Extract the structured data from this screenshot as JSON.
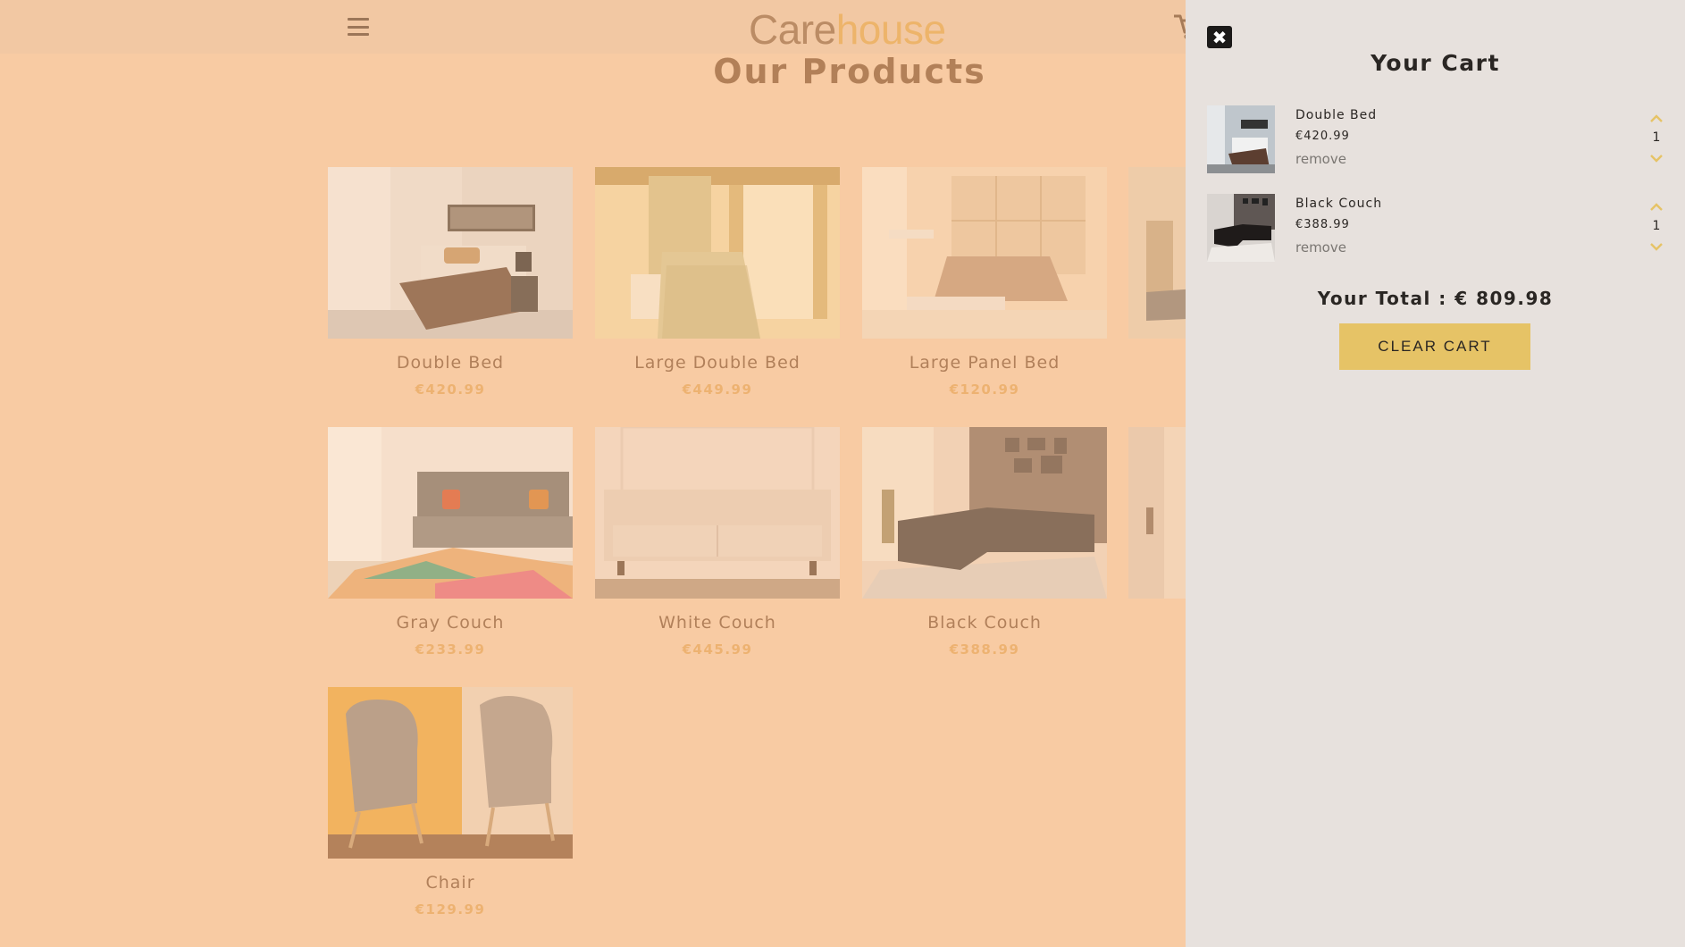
{
  "header": {
    "logo_part1": "Care",
    "logo_part2": "house",
    "menu_icon": "hamburger-menu-icon",
    "cart_icon": "shopping-cart-icon"
  },
  "products": {
    "title": "Our Products",
    "items": [
      {
        "name": "Double Bed",
        "price": "€420.99"
      },
      {
        "name": "Large Double Bed",
        "price": "€449.99"
      },
      {
        "name": "Large Panel Bed",
        "price": "€120.99"
      },
      {
        "name": "Gray Couch",
        "price": "€233.99"
      },
      {
        "name": "White Couch",
        "price": "€445.99"
      },
      {
        "name": "Black Couch",
        "price": "€388.99"
      },
      {
        "name": "Chair",
        "price": "€129.99"
      }
    ]
  },
  "cart": {
    "title": "Your Cart",
    "close_icon": "close-icon",
    "items": [
      {
        "name": "Double Bed",
        "price": "€420.99",
        "remove_label": "remove",
        "quantity": "1"
      },
      {
        "name": "Black Couch",
        "price": "€388.99",
        "remove_label": "remove",
        "quantity": "1"
      }
    ],
    "total_label": "Your Total : € 809.98",
    "clear_label": "CLEAR CART"
  },
  "colors": {
    "page_background": "#f8cca6",
    "accent": "#e6c366",
    "logo_secondary": "#e7a94f",
    "cart_panel": "#e7e1dd"
  }
}
